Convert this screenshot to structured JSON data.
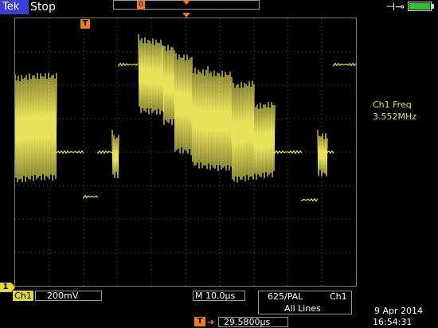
{
  "header": {
    "brand": "Tek",
    "run_state": "Stop",
    "record_marker": "0",
    "power_icon": "power-plug-icon",
    "battery_icon": "battery-icon"
  },
  "display": {
    "trigger_marker": "T",
    "ground_marker": "1",
    "trace_color": "#e8e25a",
    "accent_color": "#f07a20"
  },
  "measurement": {
    "label": "Ch1 Freq",
    "value": "3.552MHz"
  },
  "footer": {
    "channel": "Ch1",
    "volts_div": "200mV",
    "time_div": "M 10.0µs",
    "video_standard": "625/PAL",
    "trigger_source": "Ch1",
    "trigger_lines": "All Lines",
    "trigger_delay_marker": "T",
    "trigger_delay": "29.5800µs",
    "date": "9 Apr 2014",
    "time": "16:54:31"
  }
}
